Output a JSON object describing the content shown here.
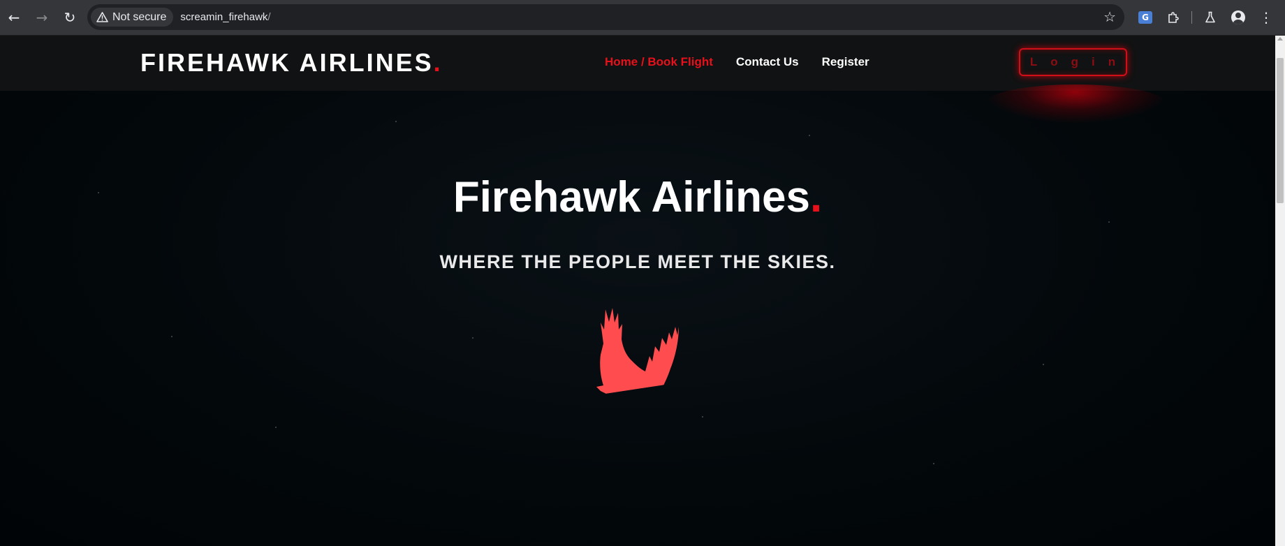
{
  "browser": {
    "security_label": "Not secure",
    "url_host": "screamin_firehawk",
    "url_path": "/"
  },
  "site": {
    "brand": "FIREHAWK AIRLINES",
    "brand_dot": ".",
    "nav": [
      {
        "label": "Home / Book Flight",
        "active": true
      },
      {
        "label": "Contact Us",
        "active": false
      },
      {
        "label": "Register",
        "active": false
      }
    ],
    "login_label": "Login"
  },
  "hero": {
    "title": "Firehawk Airlines",
    "title_dot": ".",
    "subtitle": "WHERE THE PEOPLE MEET THE SKIES."
  },
  "colors": {
    "accent_red": "#e8111b",
    "background": "#02070a",
    "navbar": "#111213"
  },
  "icons": {
    "logo": "eagle-icon"
  }
}
